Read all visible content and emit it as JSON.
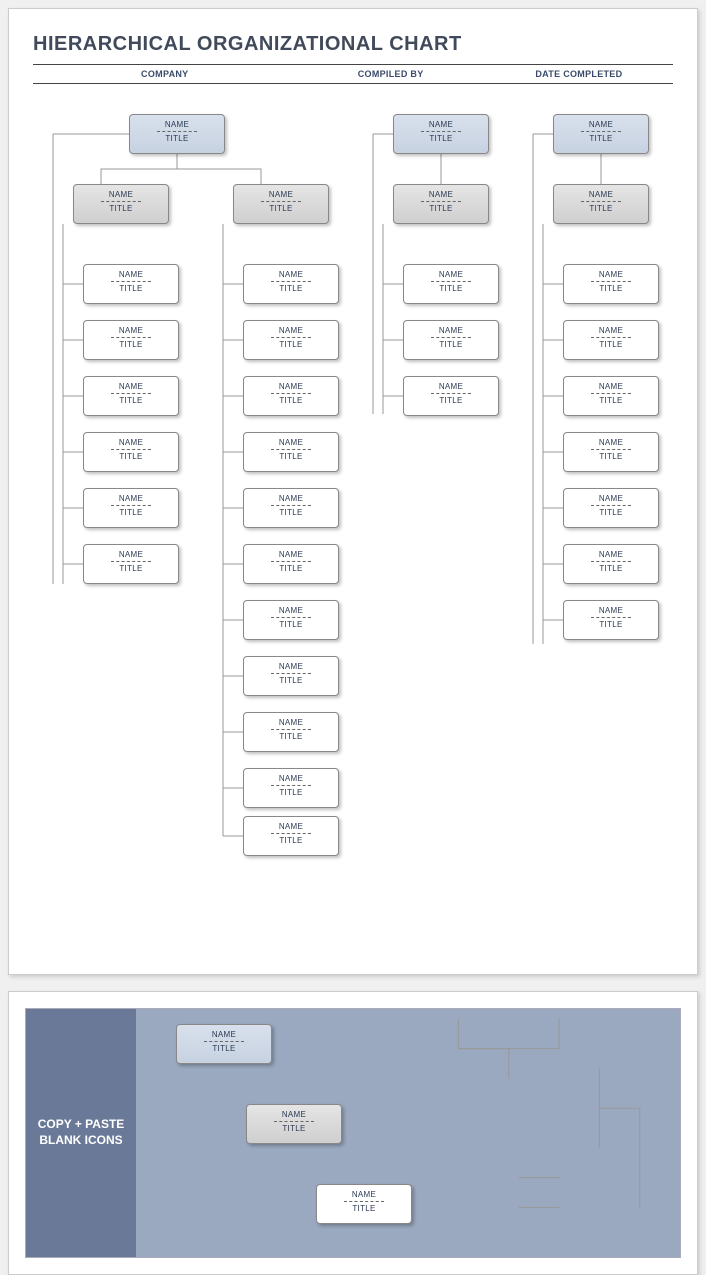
{
  "title": "HIERARCHICAL ORGANIZATIONAL CHART",
  "meta": {
    "company": "COMPANY",
    "compiled_by": "COMPILED BY",
    "date": "DATE COMPLETED"
  },
  "labels": {
    "name": "NAME",
    "title": "TITLE"
  },
  "copy_panel": {
    "heading": "COPY + PASTE\nBLANK ICONS"
  },
  "chart_data": {
    "type": "org-chart",
    "trees": [
      {
        "root": {
          "name": "NAME",
          "title": "TITLE",
          "style": "blue"
        },
        "children": [
          {
            "name": "NAME",
            "title": "TITLE",
            "style": "gray",
            "children": [
              {
                "name": "NAME",
                "title": "TITLE"
              },
              {
                "name": "NAME",
                "title": "TITLE"
              },
              {
                "name": "NAME",
                "title": "TITLE"
              },
              {
                "name": "NAME",
                "title": "TITLE"
              },
              {
                "name": "NAME",
                "title": "TITLE"
              },
              {
                "name": "NAME",
                "title": "TITLE"
              }
            ]
          },
          {
            "name": "NAME",
            "title": "TITLE",
            "style": "gray",
            "children": [
              {
                "name": "NAME",
                "title": "TITLE"
              },
              {
                "name": "NAME",
                "title": "TITLE"
              },
              {
                "name": "NAME",
                "title": "TITLE"
              },
              {
                "name": "NAME",
                "title": "TITLE"
              },
              {
                "name": "NAME",
                "title": "TITLE"
              },
              {
                "name": "NAME",
                "title": "TITLE"
              },
              {
                "name": "NAME",
                "title": "TITLE"
              },
              {
                "name": "NAME",
                "title": "TITLE"
              },
              {
                "name": "NAME",
                "title": "TITLE"
              }
            ]
          }
        ]
      },
      {
        "root": {
          "name": "NAME",
          "title": "TITLE",
          "style": "blue"
        },
        "children": [
          {
            "name": "NAME",
            "title": "TITLE",
            "style": "gray",
            "children": [
              {
                "name": "NAME",
                "title": "TITLE"
              },
              {
                "name": "NAME",
                "title": "TITLE"
              },
              {
                "name": "NAME",
                "title": "TITLE"
              }
            ]
          }
        ]
      },
      {
        "root": {
          "name": "NAME",
          "title": "TITLE",
          "style": "blue"
        },
        "children": [
          {
            "name": "NAME",
            "title": "TITLE",
            "style": "gray",
            "children": [
              {
                "name": "NAME",
                "title": "TITLE"
              },
              {
                "name": "NAME",
                "title": "TITLE"
              },
              {
                "name": "NAME",
                "title": "TITLE"
              },
              {
                "name": "NAME",
                "title": "TITLE"
              },
              {
                "name": "NAME",
                "title": "TITLE"
              },
              {
                "name": "NAME",
                "title": "TITLE"
              },
              {
                "name": "NAME",
                "title": "TITLE"
              }
            ]
          }
        ]
      }
    ],
    "palette": [
      {
        "name": "NAME",
        "title": "TITLE",
        "style": "blue"
      },
      {
        "name": "NAME",
        "title": "TITLE",
        "style": "gray"
      },
      {
        "name": "NAME",
        "title": "TITLE",
        "style": "white"
      }
    ]
  }
}
